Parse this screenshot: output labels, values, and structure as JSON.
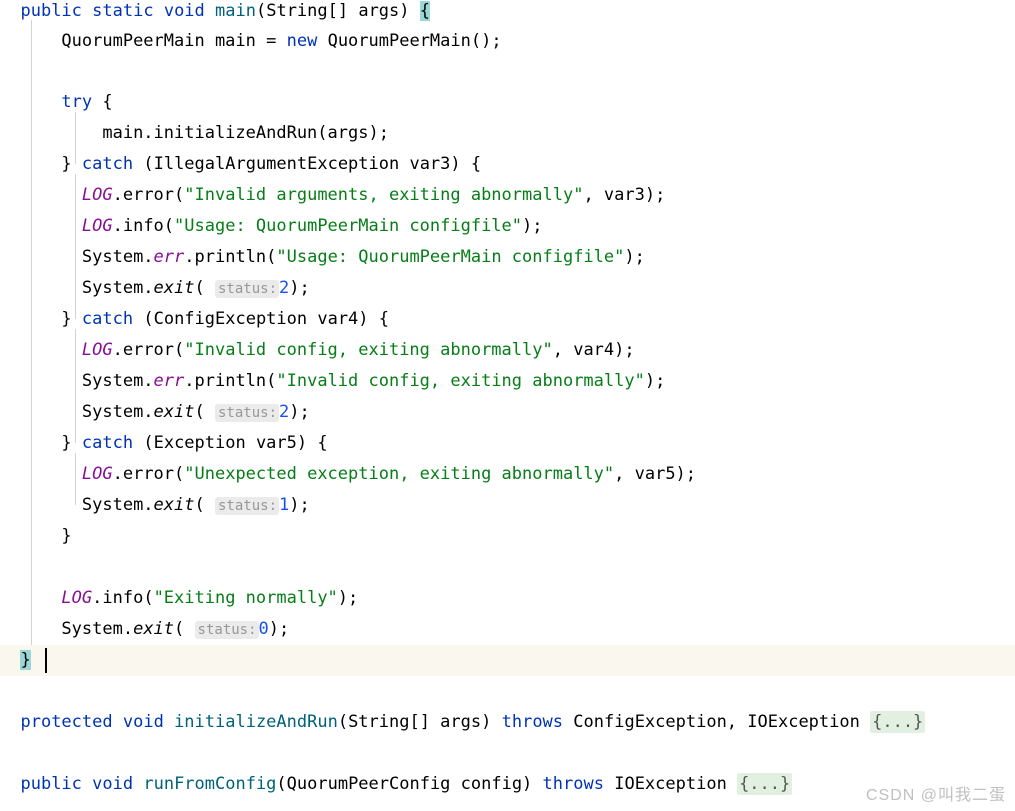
{
  "editor": {
    "language": "java",
    "background": "#ffffff",
    "caret_line_color": "#faf8ee",
    "brace_match_color": "#99d6d6",
    "fold_chip_color": "#e2f0e2",
    "hint_chip_color": "#ebebeb",
    "indent_guide_color": "#d3d3d3",
    "colors": {
      "keyword": "#0033b3",
      "string": "#067d17",
      "number": "#1750eb",
      "static_field": "#871094",
      "method_declaration": "#00627a",
      "plain": "#000000",
      "hint_text": "#989898",
      "fold_text": "#555555"
    }
  },
  "code": {
    "line1": {
      "kw_public": "public",
      "kw_static": "static",
      "kw_void": "void",
      "name_main": "main",
      "params": "(String[] args)",
      "brace": "{"
    },
    "line2": {
      "type": "QuorumPeerMain main =",
      "kw_new": "new",
      "ctor": "QuorumPeerMain();"
    },
    "line4": {
      "kw_try": "try",
      "brace": "{"
    },
    "line5": {
      "text": "main.initializeAndRun(args);"
    },
    "line6": {
      "close": "}",
      "kw_catch": "catch",
      "rest": "(IllegalArgumentException var3) {"
    },
    "line7": {
      "log": "LOG",
      "call": ".error(",
      "string": "\"Invalid arguments, exiting abnormally\"",
      "tail": ", var3);"
    },
    "line8": {
      "log": "LOG",
      "call": ".info(",
      "string": "\"Usage: QuorumPeerMain configfile\"",
      "tail": ");"
    },
    "line9": {
      "sys": "System.",
      "err": "err",
      "call": ".println(",
      "string": "\"Usage: QuorumPeerMain configfile\"",
      "tail": ");"
    },
    "line10": {
      "sys": "System.",
      "exit": "exit",
      "open": "(",
      "hint": "status:",
      "num": "2",
      "tail": ");"
    },
    "line11": {
      "close": "}",
      "kw_catch": "catch",
      "rest": "(ConfigException var4) {"
    },
    "line12": {
      "log": "LOG",
      "call": ".error(",
      "string": "\"Invalid config, exiting abnormally\"",
      "tail": ", var4);"
    },
    "line13": {
      "sys": "System.",
      "err": "err",
      "call": ".println(",
      "string": "\"Invalid config, exiting abnormally\"",
      "tail": ");"
    },
    "line14": {
      "sys": "System.",
      "exit": "exit",
      "open": "(",
      "hint": "status:",
      "num": "2",
      "tail": ");"
    },
    "line15": {
      "close": "}",
      "kw_catch": "catch",
      "rest": "(Exception var5) {"
    },
    "line16": {
      "log": "LOG",
      "call": ".error(",
      "string": "\"Unexpected exception, exiting abnormally\"",
      "tail": ", var5);"
    },
    "line17": {
      "sys": "System.",
      "exit": "exit",
      "open": "(",
      "hint": "status:",
      "num": "1",
      "tail": ");"
    },
    "line18": {
      "close": "}"
    },
    "line20": {
      "log": "LOG",
      "call": ".info(",
      "string": "\"Exiting normally\"",
      "tail": ");"
    },
    "line21": {
      "sys": "System.",
      "exit": "exit",
      "open": "(",
      "hint": "status:",
      "num": "0",
      "tail": ");"
    },
    "line22": {
      "close": "}"
    },
    "line24": {
      "kw_protected": "protected",
      "kw_void": "void",
      "name": "initializeAndRun",
      "params": "(String[] args)",
      "kw_throws": "throws",
      "exceptions": "ConfigException, IOException",
      "fold": "{...}"
    },
    "line26": {
      "kw_public": "public",
      "kw_void": "void",
      "name": "runFromConfig",
      "params": "(QuorumPeerConfig config)",
      "kw_throws": "throws",
      "exceptions": "IOException",
      "fold": "{...}"
    }
  },
  "watermark": {
    "text": "CSDN @叫我二蛋"
  }
}
